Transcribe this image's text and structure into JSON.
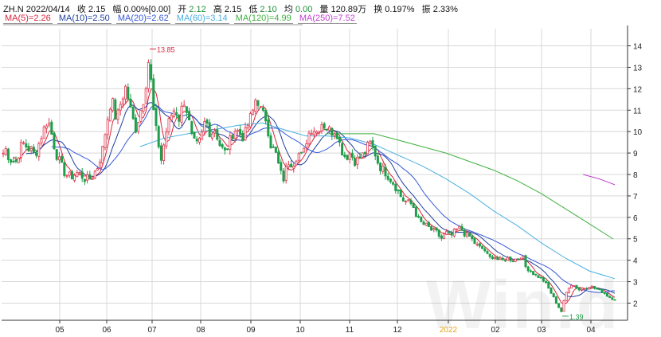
{
  "header": {
    "symbol_date": "ZH.N 2022/04/14",
    "close_label": "收",
    "close": "2.15",
    "change_label": "幅",
    "change": "0.00%[0.00]",
    "open_label": "开",
    "open": "2.12",
    "high_label": "高",
    "high": "2.15",
    "low_label": "低",
    "low": "2.10",
    "avg_label": "均",
    "avg": "0.00",
    "volume_label": "量",
    "volume": "120.89万",
    "turnover_label": "换",
    "turnover": "0.197%",
    "amplitude_label": "振",
    "amplitude": "2.33%"
  },
  "ma_legend": [
    {
      "label": "MA(5)=2.26",
      "color": "#d6263c"
    },
    {
      "label": "MA(10)=2.50",
      "color": "#1f3e9e"
    },
    {
      "label": "MA(20)=2.62",
      "color": "#3558d8"
    },
    {
      "label": "MA(60)=3.14",
      "color": "#48b0e0"
    },
    {
      "label": "MA(120)=4.99",
      "color": "#3fb13f"
    },
    {
      "label": "MA(250)=7.52",
      "color": "#c23fd0"
    }
  ],
  "chart_data": {
    "type": "candlestick",
    "ylim": [
      1.2,
      14.8
    ],
    "ytick_labels": [
      "2",
      "3",
      "4",
      "5",
      "6",
      "7",
      "8",
      "9",
      "10",
      "11",
      "12",
      "13",
      "14"
    ],
    "xtick_labels": [
      "05",
      "06",
      "07",
      "08",
      "09",
      "10",
      "11",
      "12",
      "2022",
      "02",
      "03",
      "04"
    ],
    "annotations": [
      {
        "text": "13.85",
        "value": 13.85
      },
      {
        "text": "1.39",
        "value": 1.39
      }
    ],
    "colors": {
      "up": "#e03a50",
      "down": "#1e9e4a",
      "grid": "#d8d8d8",
      "year_tick": "#e8a317"
    },
    "close_path": [
      [
        0,
        8.4
      ],
      [
        6,
        9.3
      ],
      [
        12,
        8.7
      ],
      [
        20,
        8.6
      ],
      [
        28,
        9.5
      ],
      [
        36,
        9.2
      ],
      [
        44,
        8.9
      ],
      [
        52,
        9.8
      ],
      [
        60,
        10.6
      ],
      [
        66,
        9.7
      ],
      [
        70,
        9.0
      ],
      [
        76,
        8.5
      ],
      [
        82,
        8.0
      ],
      [
        90,
        7.9
      ],
      [
        98,
        8.1
      ],
      [
        106,
        7.8
      ],
      [
        114,
        7.8
      ],
      [
        122,
        8.3
      ],
      [
        128,
        9.0
      ],
      [
        134,
        10.4
      ],
      [
        140,
        11.6
      ],
      [
        146,
        10.5
      ],
      [
        152,
        11.4
      ],
      [
        158,
        12.1
      ],
      [
        164,
        11.0
      ],
      [
        170,
        10.1
      ],
      [
        176,
        10.9
      ],
      [
        182,
        11.8
      ],
      [
        186,
        13.4
      ],
      [
        190,
        12.2
      ],
      [
        194,
        10.4
      ],
      [
        198,
        9.7
      ],
      [
        202,
        8.6
      ],
      [
        208,
        9.9
      ],
      [
        214,
        10.7
      ],
      [
        220,
        11.1
      ],
      [
        226,
        10.5
      ],
      [
        230,
        11.6
      ],
      [
        236,
        10.8
      ],
      [
        240,
        9.8
      ],
      [
        246,
        9.3
      ],
      [
        252,
        9.6
      ],
      [
        258,
        10.6
      ],
      [
        264,
        9.9
      ],
      [
        270,
        10.1
      ],
      [
        276,
        9.4
      ],
      [
        282,
        9.0
      ],
      [
        288,
        9.5
      ],
      [
        294,
        10.1
      ],
      [
        300,
        10.0
      ],
      [
        306,
        9.7
      ],
      [
        312,
        10.4
      ],
      [
        318,
        11.0
      ],
      [
        322,
        11.7
      ],
      [
        328,
        10.9
      ],
      [
        334,
        10.6
      ],
      [
        340,
        9.4
      ],
      [
        346,
        9.0
      ],
      [
        352,
        8.1
      ],
      [
        356,
        7.8
      ],
      [
        362,
        8.6
      ],
      [
        368,
        8.5
      ],
      [
        374,
        9.0
      ],
      [
        380,
        8.8
      ],
      [
        386,
        9.8
      ],
      [
        392,
        10.2
      ],
      [
        398,
        10.0
      ],
      [
        404,
        10.4
      ],
      [
        410,
        10.2
      ],
      [
        416,
        10.0
      ],
      [
        422,
        10.1
      ],
      [
        428,
        9.2
      ],
      [
        434,
        8.8
      ],
      [
        440,
        9.0
      ],
      [
        446,
        8.6
      ],
      [
        452,
        8.8
      ],
      [
        458,
        9.0
      ],
      [
        464,
        9.5
      ],
      [
        470,
        9.1
      ],
      [
        476,
        8.4
      ],
      [
        482,
        8.2
      ],
      [
        488,
        7.9
      ],
      [
        494,
        7.6
      ],
      [
        500,
        7.2
      ],
      [
        506,
        6.8
      ],
      [
        512,
        6.7
      ],
      [
        518,
        6.6
      ],
      [
        524,
        6.0
      ],
      [
        530,
        5.7
      ],
      [
        536,
        5.6
      ],
      [
        542,
        5.4
      ],
      [
        548,
        5.3
      ],
      [
        554,
        5.0
      ],
      [
        560,
        5.3
      ],
      [
        566,
        5.1
      ],
      [
        572,
        5.4
      ],
      [
        578,
        5.5
      ],
      [
        584,
        5.2
      ],
      [
        590,
        5.1
      ],
      [
        596,
        4.8
      ],
      [
        602,
        4.6
      ],
      [
        608,
        4.5
      ],
      [
        614,
        4.1
      ],
      [
        620,
        4.2
      ],
      [
        626,
        4.0
      ],
      [
        632,
        4.0
      ],
      [
        638,
        4.1
      ],
      [
        644,
        4.0
      ],
      [
        650,
        4.1
      ],
      [
        656,
        4.2
      ],
      [
        660,
        3.7
      ],
      [
        666,
        3.5
      ],
      [
        672,
        3.3
      ],
      [
        678,
        3.2
      ],
      [
        684,
        3.0
      ],
      [
        690,
        2.6
      ],
      [
        696,
        2.2
      ],
      [
        700,
        1.9
      ],
      [
        705,
        1.6
      ],
      [
        710,
        2.4
      ],
      [
        716,
        2.9
      ],
      [
        722,
        2.8
      ],
      [
        728,
        2.6
      ],
      [
        734,
        2.7
      ],
      [
        740,
        2.8
      ],
      [
        746,
        2.7
      ],
      [
        752,
        2.6
      ],
      [
        758,
        2.5
      ],
      [
        764,
        2.3
      ],
      [
        770,
        2.2
      ],
      [
        774,
        2.15
      ]
    ],
    "series": [
      {
        "name": "MA(5)",
        "color": "#d6263c"
      },
      {
        "name": "MA(10)",
        "color": "#1f3e9e"
      },
      {
        "name": "MA(20)",
        "color": "#3558d8"
      },
      {
        "name": "MA(60)",
        "color": "#48b0e0",
        "points": [
          [
            176,
            9.3
          ],
          [
            206,
            9.7
          ],
          [
            236,
            9.9
          ],
          [
            270,
            10.1
          ],
          [
            300,
            10.3
          ],
          [
            330,
            10.4
          ],
          [
            356,
            10.1
          ],
          [
            384,
            9.8
          ],
          [
            410,
            9.8
          ],
          [
            440,
            9.7
          ],
          [
            470,
            9.4
          ],
          [
            500,
            8.9
          ],
          [
            530,
            8.4
          ],
          [
            560,
            7.8
          ],
          [
            590,
            7.1
          ],
          [
            620,
            6.3
          ],
          [
            650,
            5.6
          ],
          [
            680,
            4.8
          ],
          [
            710,
            4.1
          ],
          [
            740,
            3.5
          ],
          [
            772,
            3.14
          ]
        ]
      },
      {
        "name": "MA(120)",
        "color": "#3fb13f",
        "points": [
          [
            410,
            9.9
          ],
          [
            440,
            9.9
          ],
          [
            470,
            9.9
          ],
          [
            500,
            9.6
          ],
          [
            530,
            9.3
          ],
          [
            560,
            9.0
          ],
          [
            590,
            8.6
          ],
          [
            620,
            8.2
          ],
          [
            650,
            7.7
          ],
          [
            680,
            7.1
          ],
          [
            710,
            6.4
          ],
          [
            740,
            5.7
          ],
          [
            770,
            4.99
          ]
        ]
      },
      {
        "name": "MA(250)",
        "color": "#c23fd0",
        "points": [
          [
            732,
            8.0
          ],
          [
            752,
            7.8
          ],
          [
            772,
            7.52
          ]
        ]
      }
    ]
  }
}
